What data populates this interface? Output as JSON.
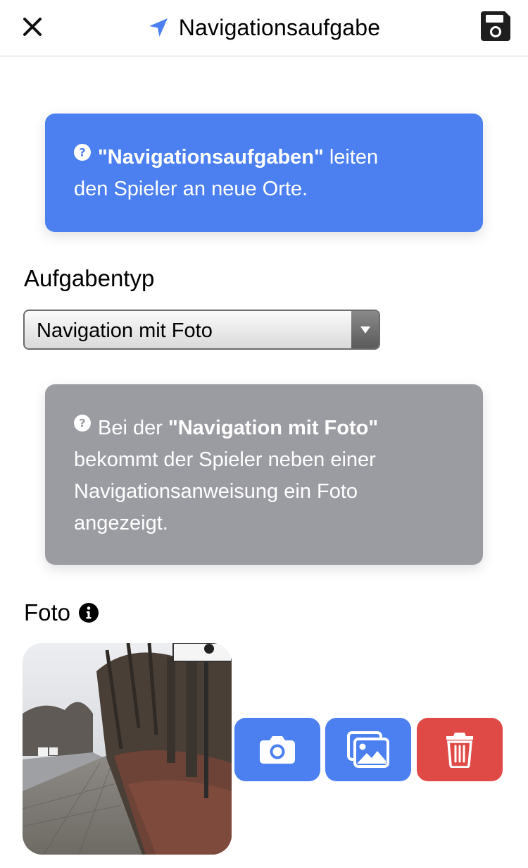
{
  "header": {
    "title": "Navigationsaufgabe",
    "close_icon": "close-icon",
    "nav_icon": "location-arrow-icon",
    "save_icon": "floppy-disk-icon"
  },
  "intro_card": {
    "highlight": "\"Navigationsaufgaben\"",
    "text_line1_rest": " leiten",
    "text_line2": "den Spieler an neue Orte.",
    "color": "#4c80f1"
  },
  "task_type": {
    "label": "Aufgabentyp",
    "selected": "Navigation mit Foto"
  },
  "type_card": {
    "text_start": "Bei der ",
    "highlight": "\"Navigation mit Foto\"",
    "text_rest": "bekommt der Spieler neben einer Navigationsanweisung ein Foto angezeigt.",
    "color": "#9b9ca2"
  },
  "photo_section": {
    "label": "Foto",
    "info_icon": "info-circle-icon",
    "buttons": {
      "camera_icon": "camera-icon",
      "gallery_icon": "images-icon",
      "delete_icon": "trash-icon"
    },
    "colors": {
      "primary": "#4c80f1",
      "danger": "#df4a46"
    }
  }
}
